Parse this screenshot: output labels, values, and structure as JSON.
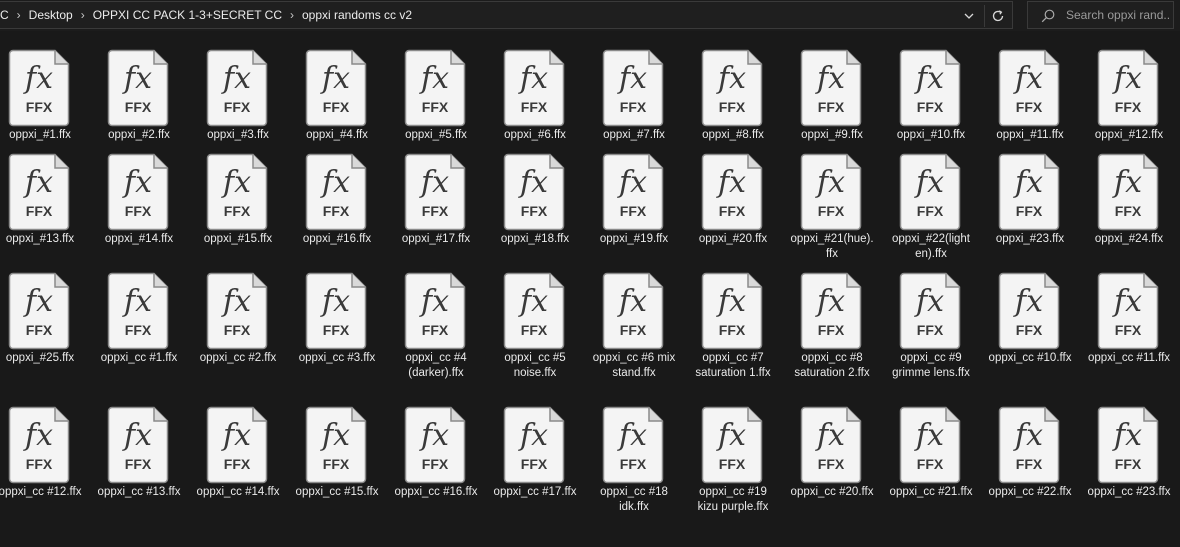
{
  "breadcrumb": {
    "items": [
      "C",
      "Desktop",
      "OPPXI CC PACK 1-3+SECRET CC",
      "oppxi randoms cc v2"
    ]
  },
  "search": {
    "placeholder": "Search oppxi rand..."
  },
  "icons": {
    "breadcrumb_separator": "chevron-right-icon",
    "address_dropdown": "chevron-down-icon",
    "refresh": "refresh-icon",
    "search": "search-icon",
    "file": "ffx-file-icon"
  },
  "file_icon": {
    "glyph": "fx",
    "type_label": "FFX"
  },
  "colors": {
    "background": "#191919",
    "icon_face": "#f4f4f4",
    "icon_ink": "#3a3a3a",
    "text": "#eaeaea"
  },
  "files": [
    [
      "oppxi_#1.ffx",
      "oppxi_#2.ffx",
      "oppxi_#3.ffx",
      "oppxi_#4.ffx",
      "oppxi_#5.ffx",
      "oppxi_#6.ffx",
      "oppxi_#7.ffx",
      "oppxi_#8.ffx",
      "oppxi_#9.ffx",
      "oppxi_#10.ffx",
      "oppxi_#11.ffx",
      "oppxi_#12.ffx"
    ],
    [
      "oppxi_#13.ffx",
      "oppxi_#14.ffx",
      "oppxi_#15.ffx",
      "oppxi_#16.ffx",
      "oppxi_#17.ffx",
      "oppxi_#18.ffx",
      "oppxi_#19.ffx",
      "oppxi_#20.ffx",
      "oppxi_#21(hue).ffx",
      "oppxi_#22(lighten).ffx",
      "oppxi_#23.ffx",
      "oppxi_#24.ffx"
    ],
    [
      "oppxi_#25.ffx",
      "oppxi_cc #1.ffx",
      "oppxi_cc #2.ffx",
      "oppxi_cc #3.ffx",
      "oppxi_cc #4 (darker).ffx",
      "oppxi_cc #5 noise.ffx",
      "oppxi_cc #6 mix stand.ffx",
      "oppxi_cc #7 saturation 1.ffx",
      "oppxi_cc #8 saturation 2.ffx",
      "oppxi_cc #9 grimme lens.ffx",
      "oppxi_cc #10.ffx",
      "oppxi_cc #11.ffx"
    ],
    [
      "oppxi_cc #12.ffx",
      "oppxi_cc #13.ffx",
      "oppxi_cc #14.ffx",
      "oppxi_cc #15.ffx",
      "oppxi_cc #16.ffx",
      "oppxi_cc #17.ffx",
      "oppxi_cc #18 idk.ffx",
      "oppxi_cc #19 kizu purple.ffx",
      "oppxi_cc #20.ffx",
      "oppxi_cc #21.ffx",
      "oppxi_cc #22.ffx",
      "oppxi_cc #23.ffx"
    ]
  ]
}
